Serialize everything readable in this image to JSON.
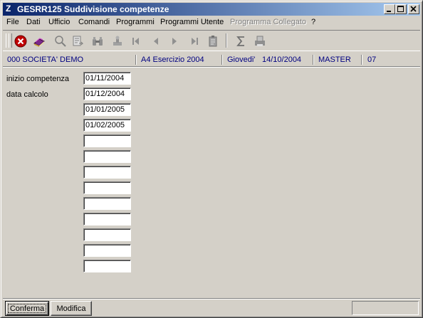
{
  "window": {
    "app_icon": "Z",
    "title": "GESRR125  Suddivisione competenze"
  },
  "menu": {
    "items": [
      {
        "label": "File",
        "disabled": false
      },
      {
        "label": "Dati",
        "disabled": false
      },
      {
        "label": "Ufficio",
        "disabled": false
      },
      {
        "label": "Comandi",
        "disabled": false
      },
      {
        "label": "Programmi",
        "disabled": false
      },
      {
        "label": "Programmi Utente",
        "disabled": false
      },
      {
        "label": "Programma Collegato",
        "disabled": true
      },
      {
        "label": "?",
        "disabled": false
      }
    ]
  },
  "toolbar": {
    "icons": [
      "close-red-icon",
      "book-icon",
      "search-icon",
      "document-arrow-icon",
      "binoculars-icon",
      "stamp-icon",
      "first-record-icon",
      "previous-record-icon",
      "next-record-icon",
      "last-record-icon",
      "clipboard-icon",
      "sigma-icon",
      "print-icon"
    ]
  },
  "info": {
    "company": "000 SOCIETA' DEMO",
    "year": "A4 Esercizio 2004",
    "day": "Giovedi'",
    "date": "14/10/2004",
    "user": "MASTER",
    "code": "07"
  },
  "form": {
    "start_label": "inizio competenza",
    "calc_label": "data calcolo",
    "fields": [
      "01/11/2004",
      "01/12/2004",
      "01/01/2005",
      "01/02/2005",
      "",
      "",
      "",
      "",
      "",
      "",
      "",
      "",
      ""
    ]
  },
  "buttons": {
    "confirm": "Conferma",
    "modify": "Modifica"
  },
  "colors": {
    "info_text": "#000080",
    "title_gradient_start": "#0a246a",
    "title_gradient_end": "#a6caf0"
  }
}
